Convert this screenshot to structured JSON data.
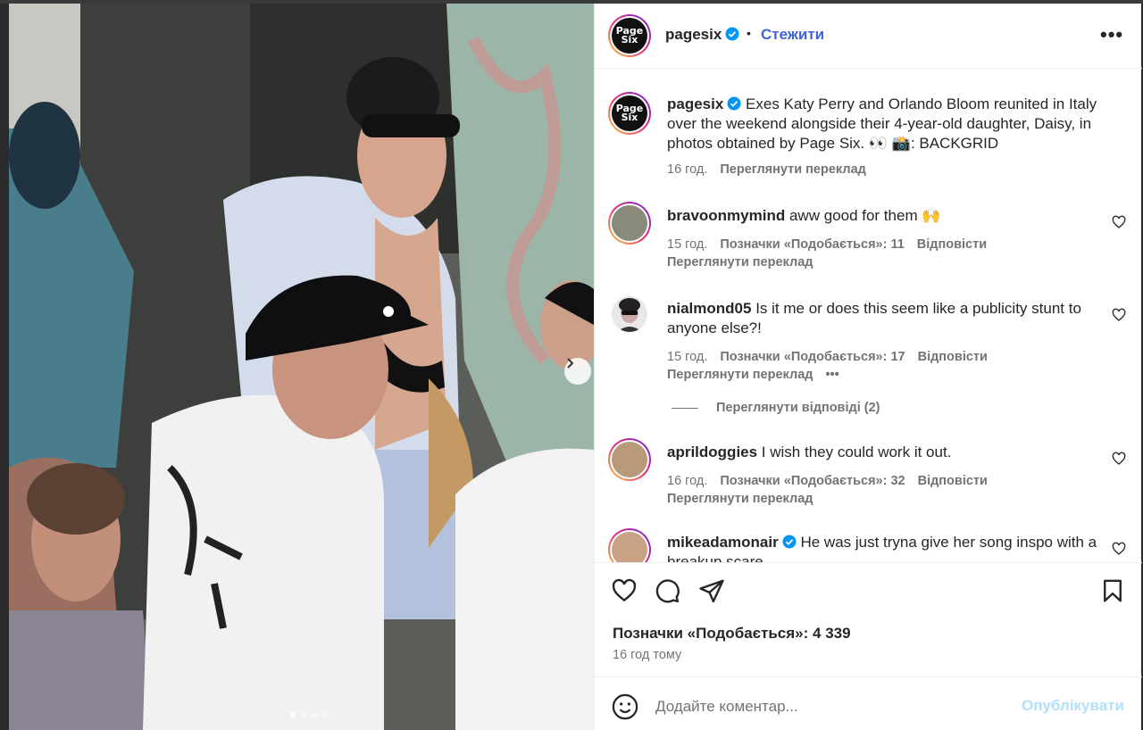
{
  "post": {
    "username": "pagesix",
    "avatar_text_top": "Page",
    "avatar_text_bottom": "Six",
    "separator": "•",
    "follow_label": "Стежити",
    "more_label": "•••",
    "caption": {
      "username": "pagesix",
      "text": " Exes Katy Perry and Orlando Bloom reunited in Italy over the weekend alongside their 4-year-old daughter, Daisy, in photos obtained by Page Six. 👀 📸: BACKGRID",
      "time": "16 год.",
      "translate": "Переглянути переклад"
    },
    "comments": [
      {
        "username": "bravoonmymind",
        "text": " aww good for them 🙌",
        "time": "15 год.",
        "likes": "Позначки «Подобається»: 11",
        "reply": "Відповісти",
        "translate": "Переглянути переклад"
      },
      {
        "username": "nialmond05",
        "text": " Is it me or does this seem like a publicity stunt to anyone else?!",
        "time": "15 год.",
        "likes": "Позначки «Подобається»: 17",
        "reply": "Відповісти",
        "translate": "Переглянути переклад",
        "more": "•••"
      },
      {
        "username": "aprildoggies",
        "text": " I wish they could work it out.",
        "time": "16 год.",
        "likes": "Позначки «Подобається»: 32",
        "reply": "Відповісти",
        "translate": "Переглянути переклад"
      },
      {
        "username": "mikeadamonair",
        "text": " He was just tryna give her song inspo with a breakup scare"
      }
    ],
    "view_replies": "Переглянути відповіді (2)",
    "likes_total": "Позначки «Подобається»: 4 339",
    "posted_ago": "16 год тому",
    "comment_placeholder": "Додайте коментар...",
    "publish_label": "Опублікувати",
    "carousel_index": 1,
    "carousel_count": 4
  },
  "colors": {
    "accent": "#3f63d8",
    "verified": "#0095f6",
    "muted": "#737373",
    "publish_disabled": "#b2dffc"
  },
  "icons": [
    "verified-badge-icon",
    "more-icon",
    "heart-icon",
    "comment-icon",
    "share-icon",
    "bookmark-icon",
    "emoji-icon",
    "chevron-right-icon"
  ]
}
